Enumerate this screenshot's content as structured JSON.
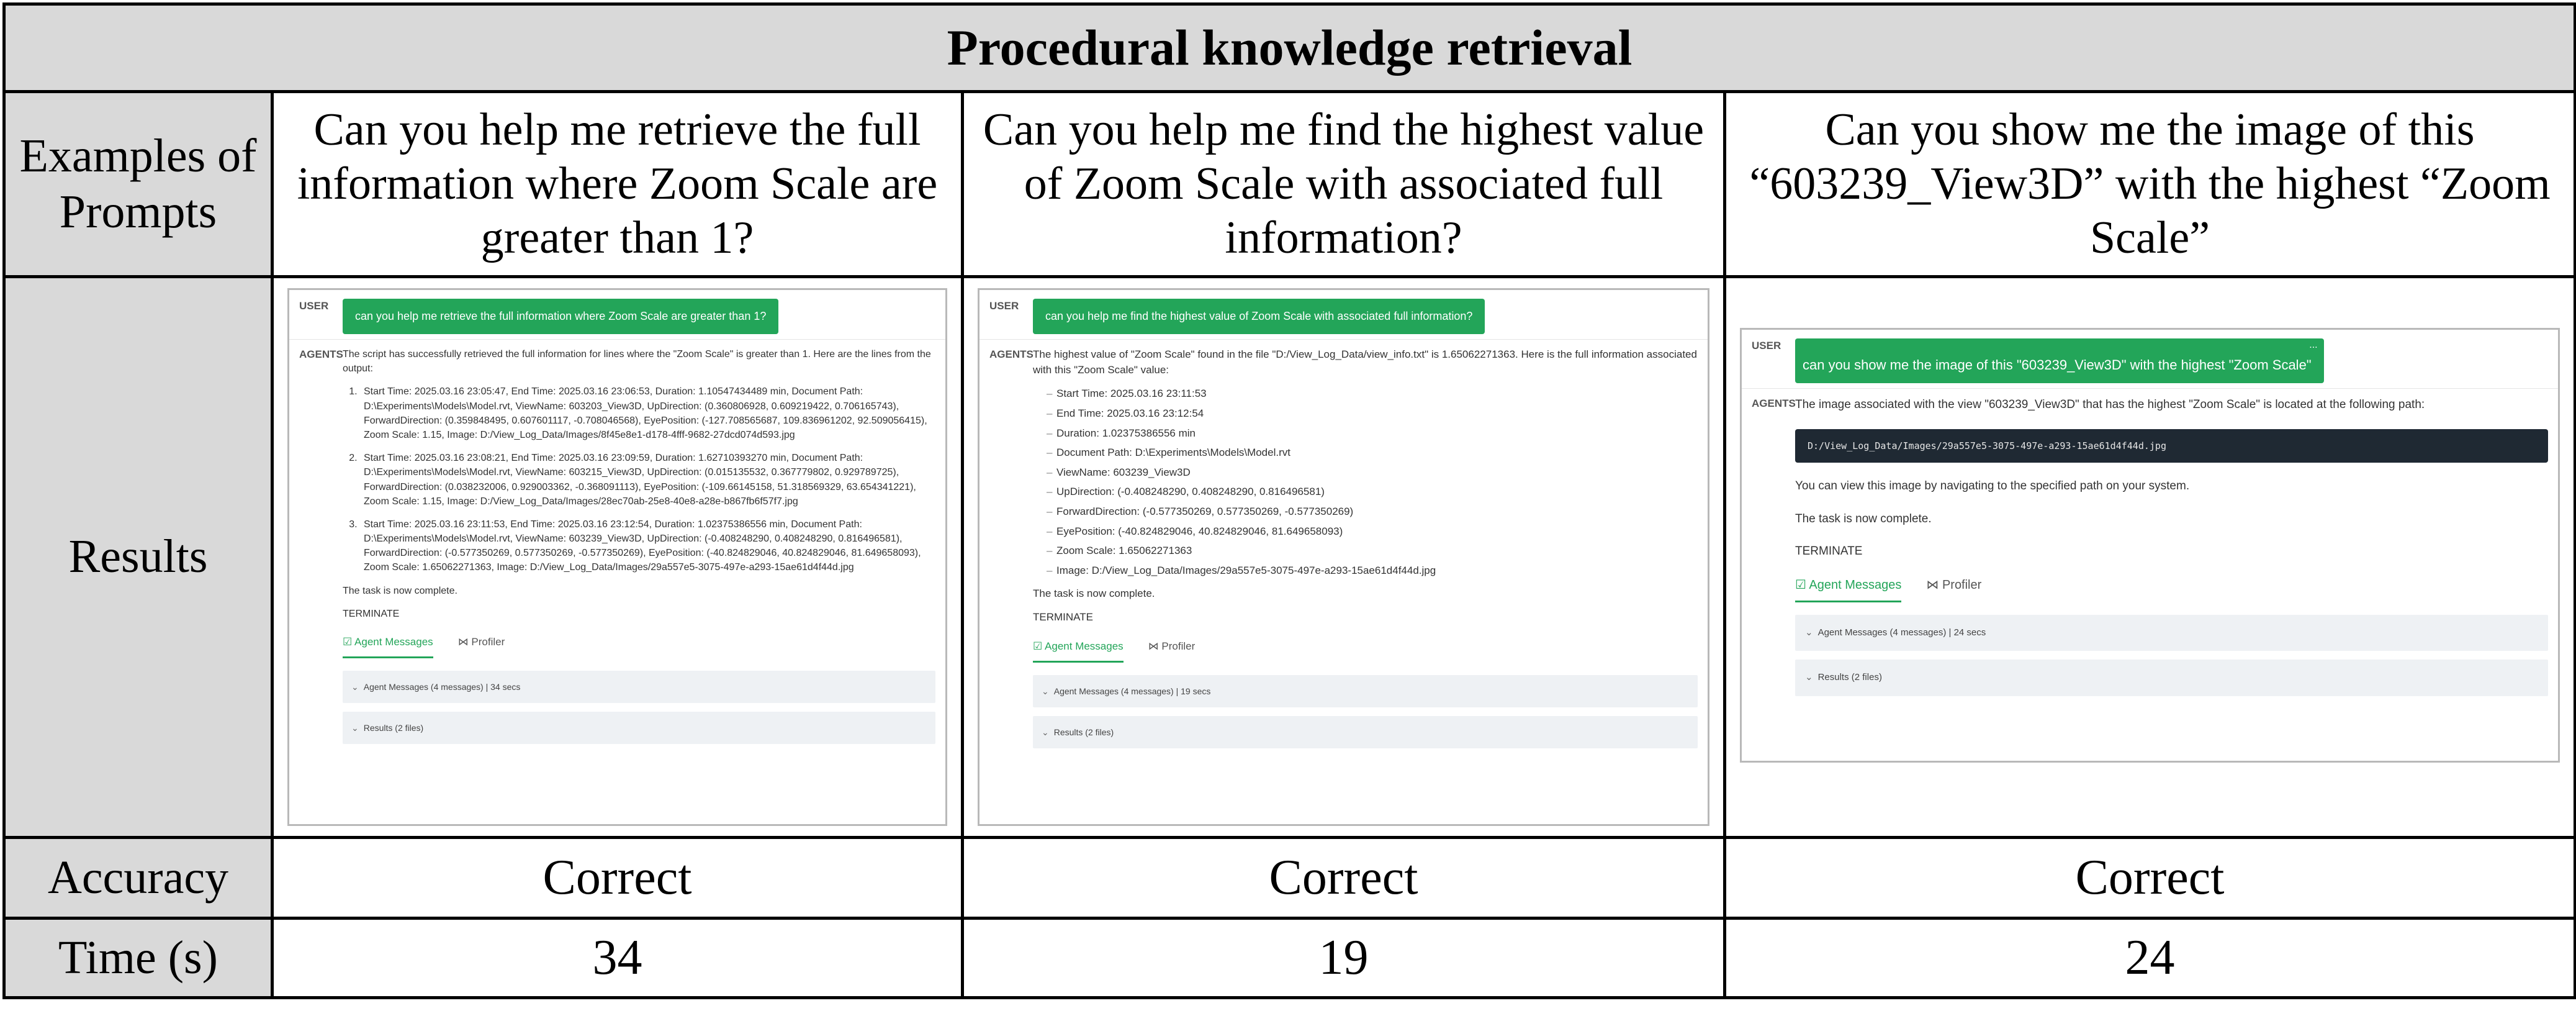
{
  "title": "Procedural knowledge retrieval",
  "row_labels": {
    "prompts": "Examples of Prompts",
    "results": "Results",
    "accuracy": "Accuracy",
    "time": "Time (s)"
  },
  "prompts": [
    "Can you help me retrieve the full information where Zoom Scale are greater than 1?",
    "Can you help me find the highest value of Zoom Scale with associated full information?",
    "Can you show me the image of this “603239_View3D” with the highest “Zoom Scale”"
  ],
  "accuracy": [
    "Correct",
    "Correct",
    "Correct"
  ],
  "time": [
    "34",
    "19",
    "24"
  ],
  "colors": {
    "header_bg": "#d9d9d9",
    "accent_green": "#23a559",
    "code_bg": "#1f2933"
  },
  "icons": {
    "agent_messages": "check-circle-icon",
    "profiler": "profiler-icon",
    "collapse": "chevron-down-icon"
  },
  "screens": {
    "user_label": "USER",
    "agents_label": "AGENTS",
    "tab_agent_messages": "Agent Messages",
    "tab_profiler": "Profiler",
    "results_files": "Results (2 files)",
    "task_complete": "The task is now complete.",
    "terminate": "TERMINATE",
    "s1": {
      "user_msg": "can you help me retrieve the full information where Zoom Scale are greater than 1?",
      "intro": "The script has successfully retrieved the full information for lines where the \"Zoom Scale\" is greater than 1. Here are the lines from the output:",
      "items": [
        "Start Time: 2025.03.16 23:05:47, End Time: 2025.03.16 23:06:53, Duration: 1.10547434489 min, Document Path: D:\\Experiments\\Models\\Model.rvt, ViewName: 603203_View3D, UpDirection: (0.360806928, 0.609219422, 0.706165743), ForwardDirection: (0.359848495, 0.607601117, -0.708046568), EyePosition: (-127.708565687, 109.836961202, 92.509056415), Zoom Scale: 1.15, Image: D:/View_Log_Data/Images/8f45e8e1-d178-4fff-9682-27dcd074d593.jpg",
        "Start Time: 2025.03.16 23:08:21, End Time: 2025.03.16 23:09:59, Duration: 1.62710393270 min, Document Path: D:\\Experiments\\Models\\Model.rvt, ViewName: 603215_View3D, UpDirection: (0.015135532, 0.367779802, 0.929789725), ForwardDirection: (0.038232006, 0.929003362, -0.368091113), EyePosition: (-109.66145158, 51.318569329, 63.654341221), Zoom Scale: 1.15, Image: D:/View_Log_Data/Images/28ec70ab-25e8-40e8-a28e-b867fb6f57f7.jpg",
        "Start Time: 2025.03.16 23:11:53, End Time: 2025.03.16 23:12:54, Duration: 1.02375386556 min, Document Path: D:\\Experiments\\Models\\Model.rvt, ViewName: 603239_View3D, UpDirection: (-0.408248290, 0.408248290, 0.816496581), ForwardDirection: (-0.577350269, 0.577350269, -0.577350269), EyePosition: (-40.824829046, 40.824829046, 81.649658093), Zoom Scale: 1.65062271363, Image: D:/View_Log_Data/Images/29a557e5-3075-497e-a293-15ae61d4f44d.jpg"
      ],
      "agent_messages_summary": "Agent Messages (4 messages) | 34 secs"
    },
    "s2": {
      "user_msg": "can you help me find the highest value of Zoom Scale with associated full information?",
      "intro": "The highest value of \"Zoom Scale\" found in the file \"D:/View_Log_Data/view_info.txt\" is 1.65062271363. Here is the full information associated with this \"Zoom Scale\" value:",
      "items": [
        "Start Time: 2025.03.16 23:11:53",
        "End Time: 2025.03.16 23:12:54",
        "Duration: 1.02375386556 min",
        "Document Path: D:\\Experiments\\Models\\Model.rvt",
        "ViewName: 603239_View3D",
        "UpDirection: (-0.408248290, 0.408248290, 0.816496581)",
        "ForwardDirection: (-0.577350269, 0.577350269, -0.577350269)",
        "EyePosition: (-40.824829046, 40.824829046, 81.649658093)",
        "Zoom Scale: 1.65062271363",
        "Image: D:/View_Log_Data/Images/29a557e5-3075-497e-a293-15ae61d4f44d.jpg"
      ],
      "agent_messages_summary": "Agent Messages (4 messages) | 19 secs"
    },
    "s3": {
      "user_msg": "can you show me the image of this \"603239_View3D\" with the highest \"Zoom Scale\"",
      "dots": "...",
      "intro": "The image associated with the view \"603239_View3D\" that has the highest \"Zoom Scale\" is located at the following path:",
      "code": "D:/View_Log_Data/Images/29a557e5-3075-497e-a293-15ae61d4f44d.jpg",
      "navigate": "You can view this image by navigating to the specified path on your system.",
      "agent_messages_summary": "Agent Messages (4 messages) | 24 secs"
    }
  }
}
